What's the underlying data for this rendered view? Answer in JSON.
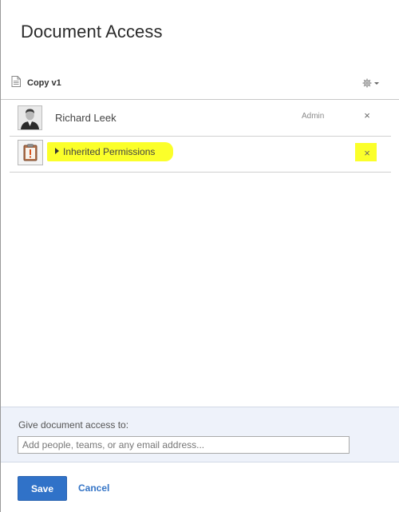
{
  "dialog": {
    "title": "Document Access"
  },
  "document": {
    "name": "Copy v1",
    "icon": "document-icon",
    "settings_icon": "gear-icon"
  },
  "access_list": {
    "users": [
      {
        "name": "Richard Leek",
        "role": "Admin",
        "avatar": "user-avatar",
        "remove_label": "×"
      }
    ],
    "inherited": {
      "label": "Inherited Permissions",
      "icon": "warning-clipboard-icon",
      "remove_label": "×",
      "highlighted": true
    }
  },
  "share": {
    "label": "Give document access to:",
    "input_value": "",
    "placeholder": "Add people, teams, or any email address..."
  },
  "footer": {
    "save_label": "Save",
    "cancel_label": "Cancel"
  },
  "colors": {
    "primary": "#3072c8",
    "link": "#3474c6",
    "highlight": "#fbff2a",
    "panel": "#eef2fa",
    "warning": "#d9531e"
  }
}
